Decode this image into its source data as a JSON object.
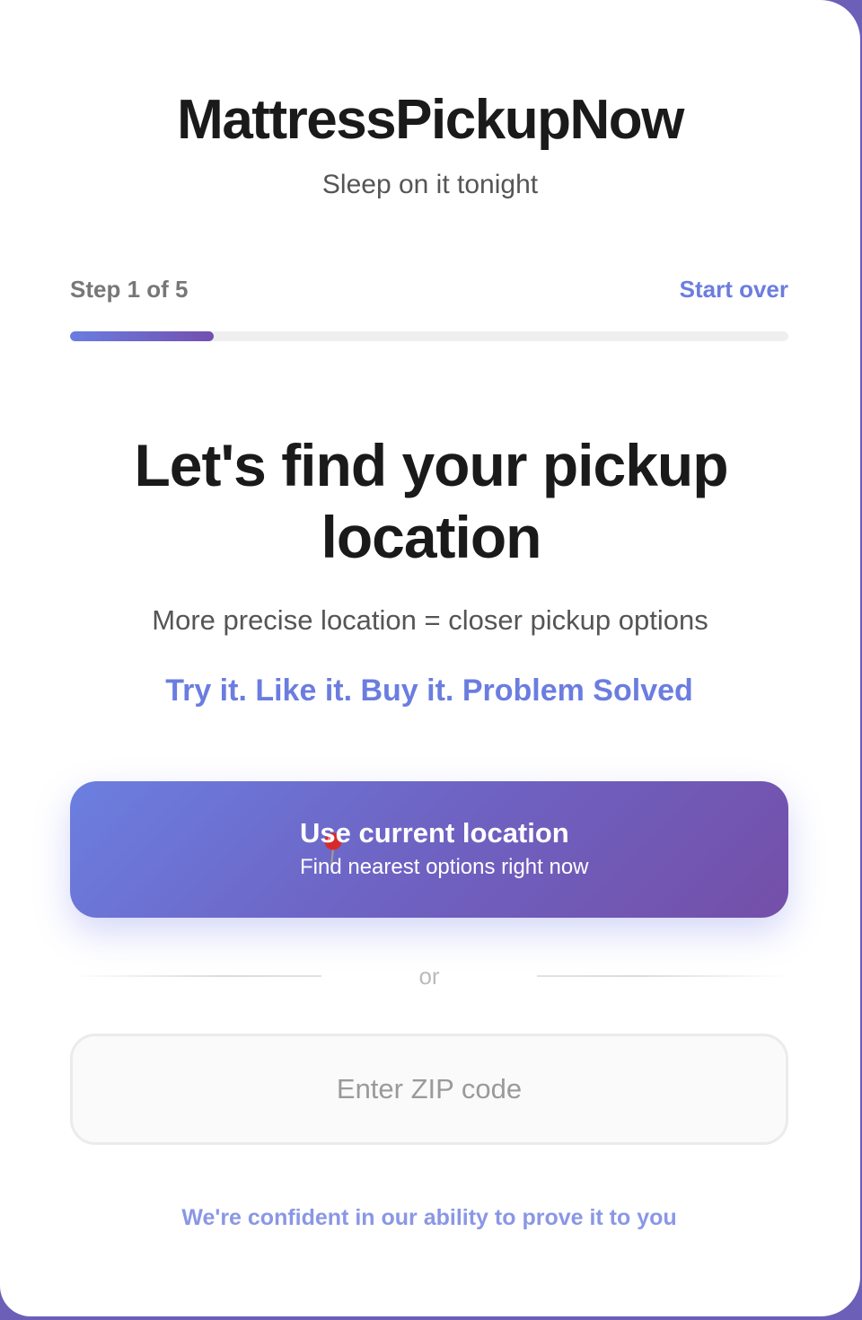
{
  "header": {
    "brand": "MattressPickupNow",
    "tagline": "Sleep on it tonight"
  },
  "progress": {
    "step_label": "Step 1 of 5",
    "start_over_label": "Start over",
    "fraction": 0.2,
    "accent_start": "#6a7de0",
    "accent_end": "#7350b0"
  },
  "main": {
    "headline": "Let's find your pickup location",
    "subtext": "More precise location = closer pickup options",
    "slogan": "Try it. Like it. Buy it. Problem Solved"
  },
  "location_button": {
    "icon": "pushpin-icon",
    "title": "Use current location",
    "subtitle": "Find nearest options right now"
  },
  "divider": {
    "text": "or"
  },
  "zip": {
    "placeholder": "Enter ZIP code",
    "value": ""
  },
  "footer": {
    "note": "We're confident in our ability to prove it to you"
  },
  "colors": {
    "accent": "#6b7ddf",
    "frame": "#6b5fb8"
  }
}
